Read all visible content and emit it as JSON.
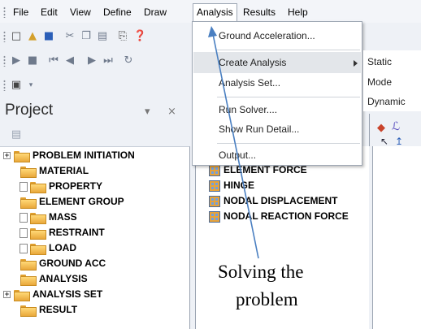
{
  "menubar": {
    "items": [
      "File",
      "Edit",
      "View",
      "Define",
      "Draw",
      "Analysis",
      "Results",
      "Help"
    ]
  },
  "project": {
    "title": "Project",
    "pin_glyph": "▾",
    "close_glyph": "×",
    "tree": [
      {
        "label": "PROBLEM INITIATION",
        "expander": "+"
      },
      {
        "label": "MATERIAL"
      },
      {
        "label": "PROPERTY"
      },
      {
        "label": "ELEMENT GROUP"
      },
      {
        "label": "MASS"
      },
      {
        "label": "RESTRAINT"
      },
      {
        "label": "LOAD"
      },
      {
        "label": "GROUND ACC"
      },
      {
        "label": "ANALYSIS"
      },
      {
        "label": "ANALYSIS SET",
        "expander": "+"
      },
      {
        "label": "RESULT"
      }
    ]
  },
  "results_list": [
    "ELEMENT FORCE",
    "HINGE",
    "NODAL DISPLACEMENT",
    "NODAL REACTION FORCE"
  ],
  "analysis_menu": {
    "items": [
      "Ground Acceleration...",
      "Create Analysis",
      "Analysis Set...",
      "Run Solver....",
      "Show Run Detail...",
      "Output..."
    ],
    "submenu": [
      "Static",
      "Mode",
      "Dynamic"
    ]
  },
  "caption": {
    "line1": "Solving the",
    "line2": "problem"
  },
  "colors": {
    "arrow": "#4a7fc1",
    "folder": "#f2c25a",
    "menu_border": "#9ea7b4"
  }
}
